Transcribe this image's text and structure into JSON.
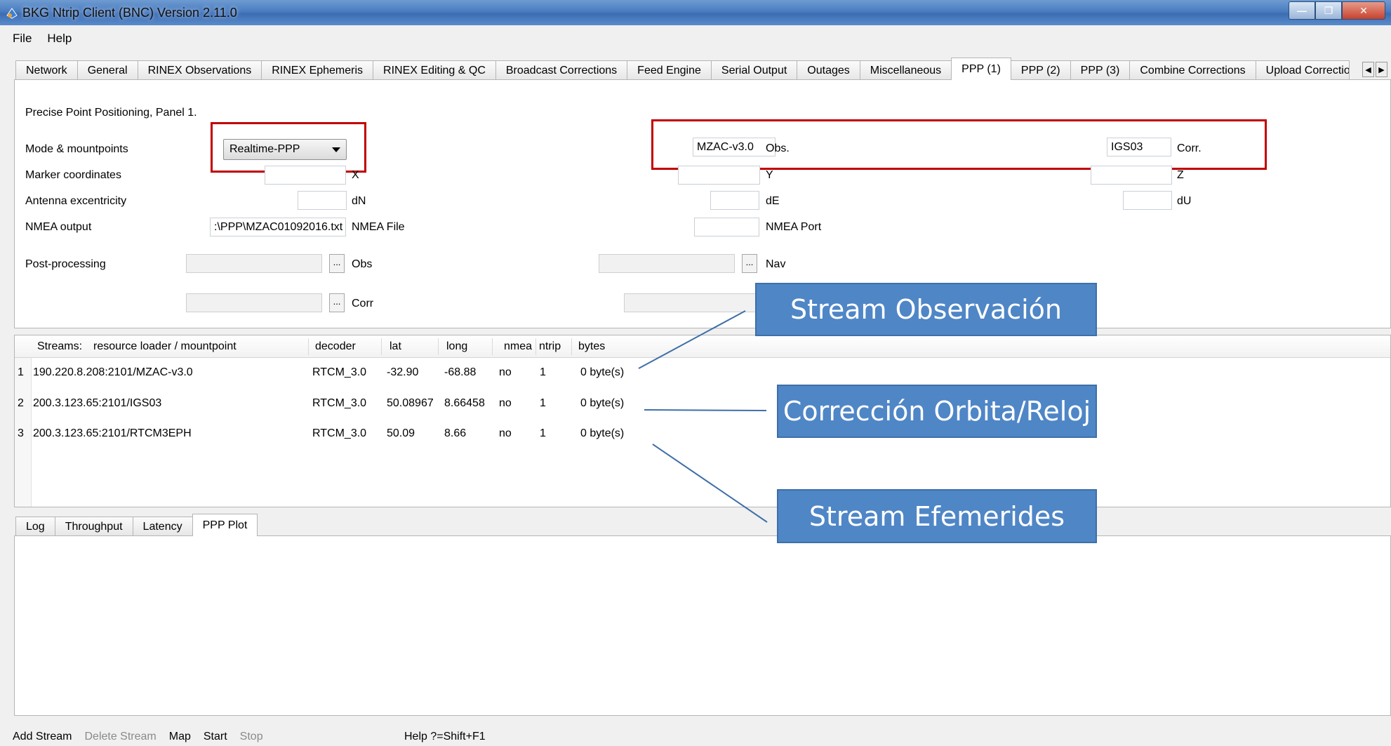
{
  "window": {
    "title": "BKG Ntrip Client (BNC) Version 2.11.0"
  },
  "menu": [
    "File",
    "Help"
  ],
  "tabs": [
    "Network",
    "General",
    "RINEX Observations",
    "RINEX Ephemeris",
    "RINEX Editing & QC",
    "Broadcast Corrections",
    "Feed Engine",
    "Serial Output",
    "Outages",
    "Miscellaneous",
    "PPP (1)",
    "PPP (2)",
    "PPP (3)",
    "Combine Corrections",
    "Upload Correction"
  ],
  "active_tab": "PPP (1)",
  "ppp": {
    "heading": "Precise Point Positioning, Panel 1.",
    "mode_label": "Mode & mountpoints",
    "mode_value": "Realtime-PPP",
    "obs_mount": "MZAC-v3.0",
    "obs_label": "Obs.",
    "corr_mount": "IGS03",
    "corr_label": "Corr.",
    "marker_label": "Marker coordinates",
    "x_label": "X",
    "y_label": "Y",
    "z_label": "Z",
    "antenna_label": "Antenna excentricity",
    "dn_label": "dN",
    "de_label": "dE",
    "du_label": "dU",
    "nmea_label": "NMEA output",
    "nmea_file_value": ":\\PPP\\MZAC01092016.txt",
    "nmea_file_label": "NMEA File",
    "nmea_port_label": "NMEA Port",
    "post_label": "Post-processing",
    "obs_short": "Obs",
    "nav_short": "Nav",
    "corr_short": "Corr",
    "browse": "..."
  },
  "streams": {
    "headers": [
      "Streams:",
      "resource loader / mountpoint",
      "decoder",
      "lat",
      "long",
      "nmea",
      "ntrip",
      "bytes"
    ],
    "rows": [
      {
        "n": "1",
        "mount": "190.220.8.208:2101/MZAC-v3.0",
        "decoder": "RTCM_3.0",
        "lat": "-32.90",
        "long": "-68.88",
        "nmea": "no",
        "ntrip": "1",
        "bytes": "0 byte(s)"
      },
      {
        "n": "2",
        "mount": "200.3.123.65:2101/IGS03",
        "decoder": "RTCM_3.0",
        "lat": "50.08967",
        "long": "8.66458",
        "nmea": "no",
        "ntrip": "1",
        "bytes": "0 byte(s)"
      },
      {
        "n": "3",
        "mount": "200.3.123.65:2101/RTCM3EPH",
        "decoder": "RTCM_3.0",
        "lat": "50.09",
        "long": "8.66",
        "nmea": "no",
        "ntrip": "1",
        "bytes": "0 byte(s)"
      }
    ]
  },
  "bottom_tabs": [
    "Log",
    "Throughput",
    "Latency",
    "PPP Plot"
  ],
  "bottom_active": "PPP Plot",
  "status": {
    "add": "Add Stream",
    "delete": "Delete Stream",
    "map": "Map",
    "start": "Start",
    "stop": "Stop",
    "help": "Help ?=Shift+F1"
  },
  "callouts": {
    "obs": "Stream Observación",
    "corr": "Corrección Orbita/Reloj",
    "eph": "Stream Efemerides"
  },
  "colors": {
    "callout": "#4f86c6",
    "highlight": "#c00000"
  }
}
